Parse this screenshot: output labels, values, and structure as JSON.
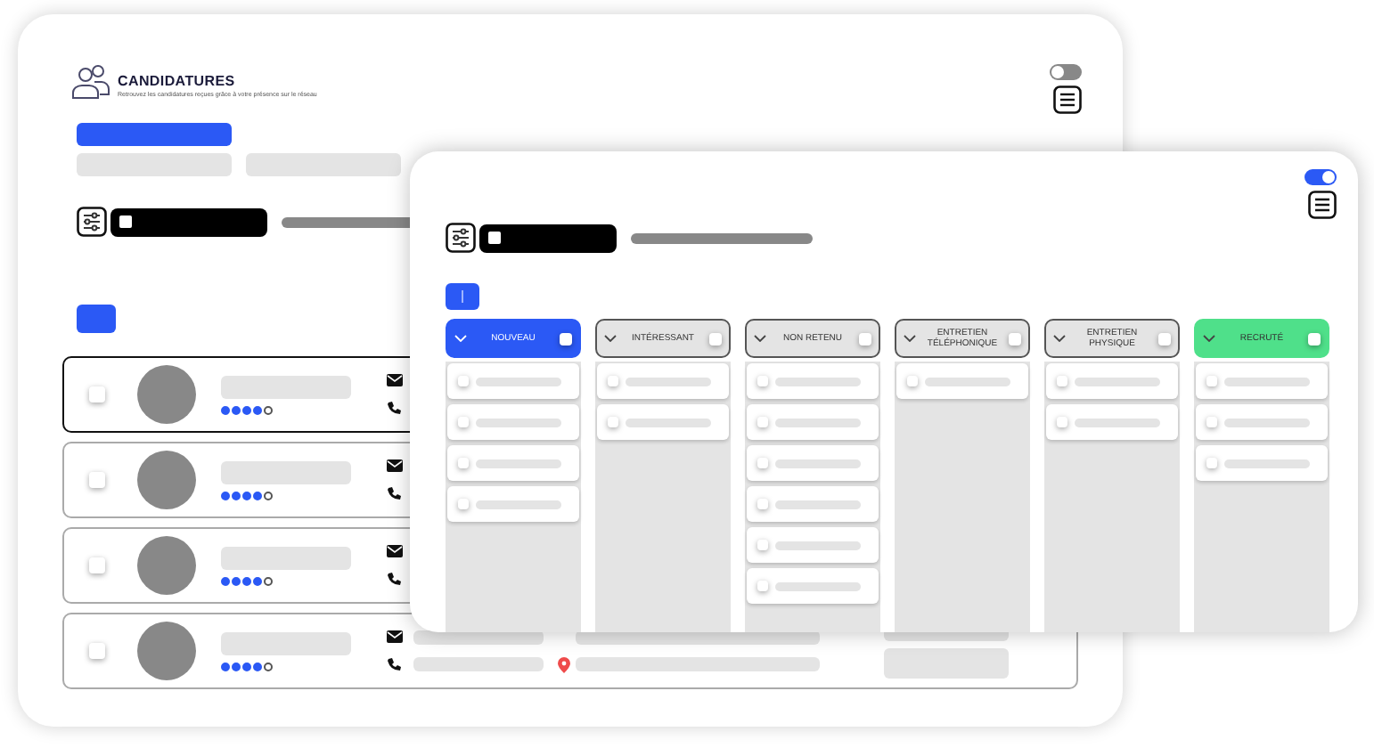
{
  "back_window": {
    "title": "CANDIDATURES",
    "subtitle": "Retrouvez les candidatures reçues grâce à votre présence sur le réseau",
    "toggle": {
      "on": false
    },
    "rows": [
      {
        "selected": true,
        "checked": false,
        "stars": 4
      },
      {
        "selected": false,
        "checked": false,
        "stars": 4
      },
      {
        "selected": false,
        "checked": false,
        "stars": 4
      },
      {
        "selected": false,
        "checked": false,
        "stars": 4
      }
    ]
  },
  "board": {
    "toggle": {
      "on": true
    },
    "columns": [
      {
        "label": "NOUVEAU",
        "color": "#2b59f5",
        "checked": false,
        "cards": [
          {
            "checked": false
          },
          {
            "checked": false
          },
          {
            "checked": false
          },
          {
            "checked": false
          }
        ]
      },
      {
        "label": "INTÉRESSANT",
        "color": "#e4e4e4",
        "checked": false,
        "cards": [
          {
            "checked": false
          },
          {
            "checked": false
          }
        ]
      },
      {
        "label": "NON RETENU",
        "color": "#e4e4e4",
        "checked": false,
        "cards": [
          {
            "checked": false
          },
          {
            "checked": false
          },
          {
            "checked": false
          },
          {
            "checked": false
          },
          {
            "checked": false
          },
          {
            "checked": false
          }
        ]
      },
      {
        "label": "ENTRETIEN TÉLÉPHONIQUE",
        "color": "#e4e4e4",
        "checked": false,
        "cards": [
          {
            "checked": false
          }
        ]
      },
      {
        "label": "ENTRETIEN PHYSIQUE",
        "color": "#e4e4e4",
        "checked": false,
        "cards": [
          {
            "checked": false
          },
          {
            "checked": false
          }
        ]
      },
      {
        "label": "RECRUTÉ",
        "color": "#4fe08a",
        "checked": false,
        "cards": [
          {
            "checked": false
          },
          {
            "checked": false
          },
          {
            "checked": false
          }
        ]
      }
    ]
  }
}
